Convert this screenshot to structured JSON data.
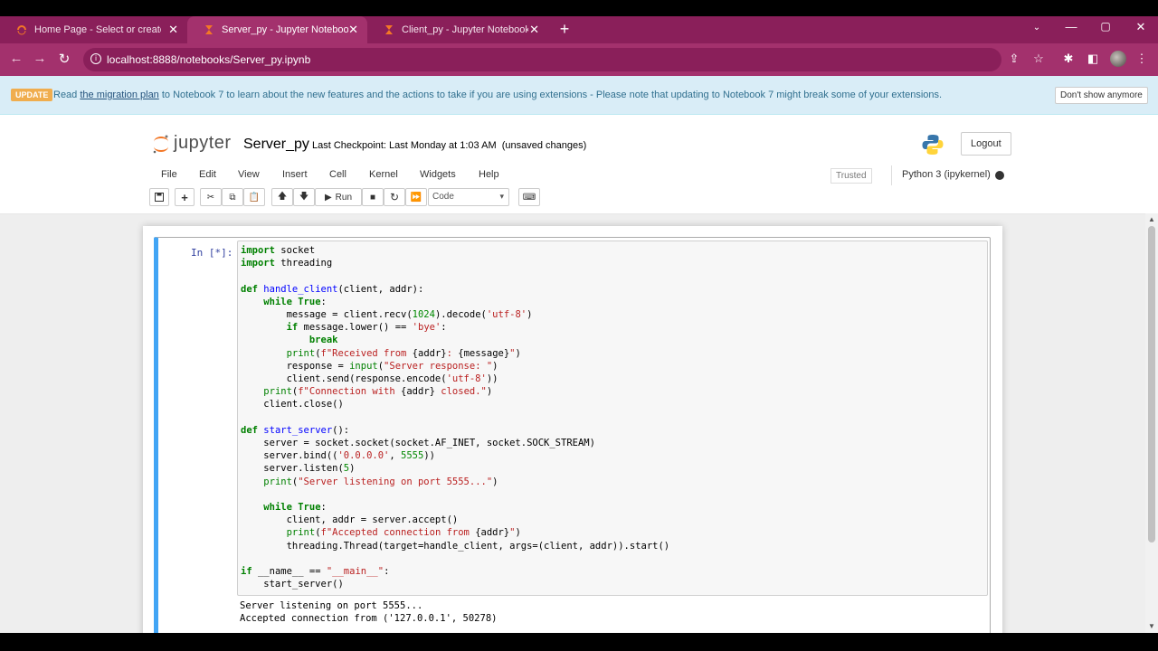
{
  "browser": {
    "tabs": [
      {
        "label": "Home Page - Select or create a n",
        "active": false
      },
      {
        "label": "Server_py - Jupyter Notebook",
        "active": true
      },
      {
        "label": "Client_py - Jupyter Notebook",
        "active": false
      }
    ],
    "url": "localhost:8888/notebooks/Server_py.ipynb",
    "new_tab": "+",
    "close_glyph": "✕"
  },
  "banner": {
    "badge": "UPDATE",
    "pre_link": "Read ",
    "link_text": "the migration plan",
    "post_link": " to Notebook 7 to learn about the new features and the actions to take if you are using extensions - Please note that updating to Notebook 7 might break some of your extensions.",
    "dismiss": "Don't show anymore"
  },
  "header": {
    "logo_text": "jupyter",
    "notebook_name": "Server_py",
    "checkpoint": "Last Checkpoint: Last Monday at 1:03 AM",
    "unsaved": "(unsaved changes)",
    "logout": "Logout"
  },
  "menubar": {
    "items": [
      "File",
      "Edit",
      "View",
      "Insert",
      "Cell",
      "Kernel",
      "Widgets",
      "Help"
    ],
    "trusted": "Trusted",
    "kernel": "Python 3 (ipykernel)"
  },
  "toolbar": {
    "run_label": "Run",
    "cell_type": "Code"
  },
  "cell": {
    "prompt": "In [*]:",
    "output": "Server listening on port 5555...\nAccepted connection from ('127.0.0.1', 50278)"
  },
  "colors": {
    "tabbar": "#8a1f5a",
    "active_tab": "#a3316d",
    "cell_selected_border": "#42a5f5",
    "banner_bg": "#d9edf7"
  }
}
